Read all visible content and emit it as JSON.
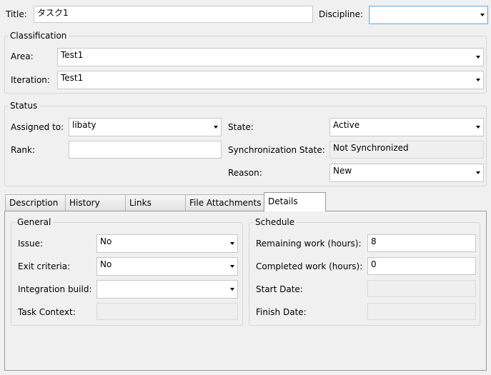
{
  "header": {
    "title_label": "Title:",
    "title_value": "タスク1",
    "discipline_label": "Discipline:",
    "discipline_value": ""
  },
  "classification": {
    "group_title": "Classification",
    "area_label": "Area:",
    "area_value": "Test1",
    "iteration_label": "Iteration:",
    "iteration_value": "Test1"
  },
  "status": {
    "group_title": "Status",
    "assigned_label": "Assigned to:",
    "assigned_value": "libaty",
    "rank_label": "Rank:",
    "rank_value": "",
    "state_label": "State:",
    "state_value": "Active",
    "sync_label": "Synchronization State:",
    "sync_value": "Not Synchronized",
    "reason_label": "Reason:",
    "reason_value": "New"
  },
  "tabs": [
    {
      "label": "Description",
      "active": false
    },
    {
      "label": "History",
      "active": false
    },
    {
      "label": "Links",
      "active": false
    },
    {
      "label": "File Attachments",
      "active": false
    },
    {
      "label": "Details",
      "active": true
    }
  ],
  "details": {
    "general": {
      "group_title": "General",
      "issue_label": "Issue:",
      "issue_value": "No",
      "exit_label": "Exit criteria:",
      "exit_value": "No",
      "build_label": "Integration build:",
      "build_value": "",
      "context_label": "Task Context:",
      "context_value": ""
    },
    "schedule": {
      "group_title": "Schedule",
      "remaining_label": "Remaining work (hours):",
      "remaining_value": "8",
      "completed_label": "Completed work (hours):",
      "completed_value": "0",
      "start_label": "Start Date:",
      "start_value": "",
      "finish_label": "Finish Date:",
      "finish_value": ""
    }
  }
}
